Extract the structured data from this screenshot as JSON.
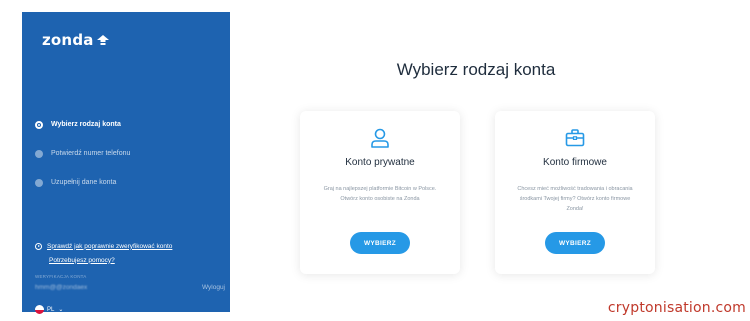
{
  "brand": {
    "name": "zonda"
  },
  "sidebar": {
    "steps": [
      {
        "label": "Wybierz rodzaj konta",
        "active": true
      },
      {
        "label": "Potwierdź numer telefonu",
        "active": false
      },
      {
        "label": "Uzupełnij dane konta",
        "active": false
      }
    ],
    "help": {
      "verify_link": "Sprawdź jak poprawnie zweryfikować konto",
      "need_help_link": "Potrzebujesz pomocy?"
    },
    "account": {
      "label": "WERYFIKACJA KONTA",
      "email": "hmm@@zondaex",
      "logout": "Wyloguj"
    },
    "language": {
      "code": "PL"
    }
  },
  "main": {
    "title": "Wybierz rodzaj konta",
    "cards": {
      "personal": {
        "title": "Konto prywatne",
        "description": "Graj na najlepszej platformie Bitcoin w Polsce. Otwórz konto osobiste na Zonda",
        "button": "WYBIERZ",
        "icon": "user-icon"
      },
      "business": {
        "title": "Konto firmowe",
        "description": "Chcesz mieć możliwość tradowania i obracania środkami Twojej firmy? Otwórz konto firmowe Zonda!",
        "button": "WYBIERZ",
        "icon": "briefcase-icon"
      }
    }
  },
  "watermark": "cryptonisation.com",
  "colors": {
    "sidebar": "#1e63b0",
    "accent": "#2699e6",
    "watermark": "#c0392b"
  }
}
